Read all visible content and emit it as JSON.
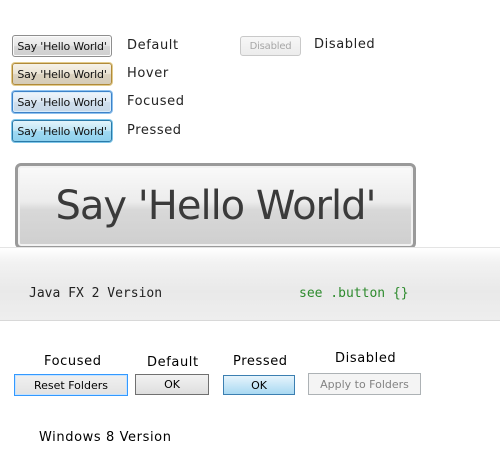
{
  "javafx": {
    "button_text": "Say 'Hello World'",
    "states": {
      "default": "Default",
      "hover": "Hover",
      "focused": "Focused",
      "pressed": "Pressed",
      "disabled": "Disabled"
    },
    "disabled_button_text": "Disabled",
    "large_button_text": "Say 'Hello World'",
    "version_label": "Java FX 2 Version",
    "css_hint": "see .button {}",
    "css_hint_color": "#2e8b2e"
  },
  "windows8": {
    "states": {
      "focused": "Focused",
      "default": "Default",
      "pressed": "Pressed",
      "disabled": "Disabled"
    },
    "buttons": {
      "reset_folders": "Reset Folders",
      "ok_default": "OK",
      "ok_pressed": "OK",
      "apply_to_folders": "Apply to Folders"
    },
    "version_label": "Windows 8 Version"
  }
}
